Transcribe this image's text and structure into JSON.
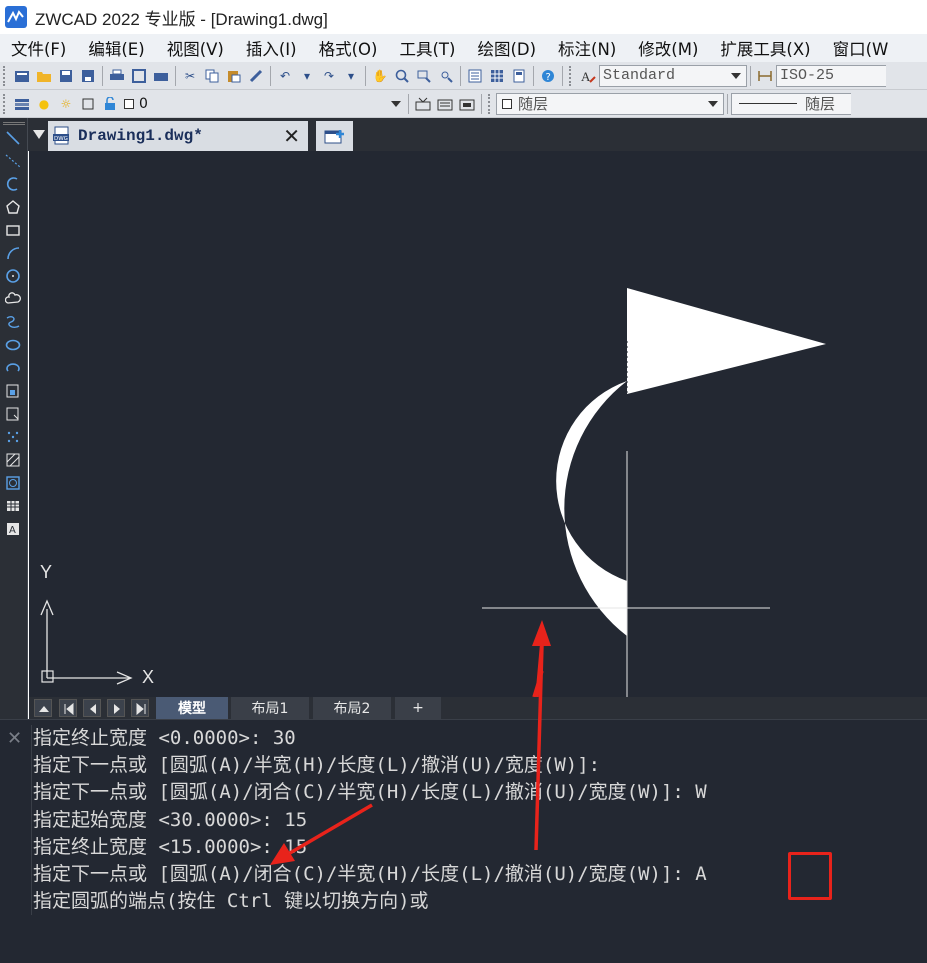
{
  "window": {
    "title": "ZWCAD 2022 专业版 - [Drawing1.dwg]"
  },
  "menu": {
    "items": [
      "文件(F)",
      "编辑(E)",
      "视图(V)",
      "插入(I)",
      "格式(O)",
      "工具(T)",
      "绘图(D)",
      "标注(N)",
      "修改(M)",
      "扩展工具(X)",
      "窗口(W"
    ]
  },
  "toolbar1": {
    "text_style": "Standard",
    "dim_style": "ISO-25"
  },
  "toolbar2": {
    "layer_name": "0",
    "color_value": "随层",
    "linetype_value": "随层"
  },
  "document_tab": {
    "label": "Drawing1.dwg*"
  },
  "canvas": {
    "ucs_x_label": "X",
    "ucs_y_label": "Y",
    "background": "#232832"
  },
  "layout_tabs": {
    "items": [
      "模型",
      "布局1",
      "布局2",
      "+"
    ],
    "active": "模型"
  },
  "command_line": {
    "lines": [
      "指定终止宽度 <0.0000>: 30",
      "指定下一点或 [圆弧(A)/半宽(H)/长度(L)/撤消(U)/宽度(W)]:",
      "指定下一点或 [圆弧(A)/闭合(C)/半宽(H)/长度(L)/撤消(U)/宽度(W)]: W",
      "指定起始宽度 <30.0000>: 15",
      "指定终止宽度 <15.0000>: 15",
      "指定下一点或 [圆弧(A)/闭合(C)/半宽(H)/长度(L)/撤消(U)/宽度(W)]: A",
      "指定圆弧的端点(按住 Ctrl 键以切换方向)或"
    ]
  },
  "annotation": {
    "highlight_color": "#e8231b"
  }
}
